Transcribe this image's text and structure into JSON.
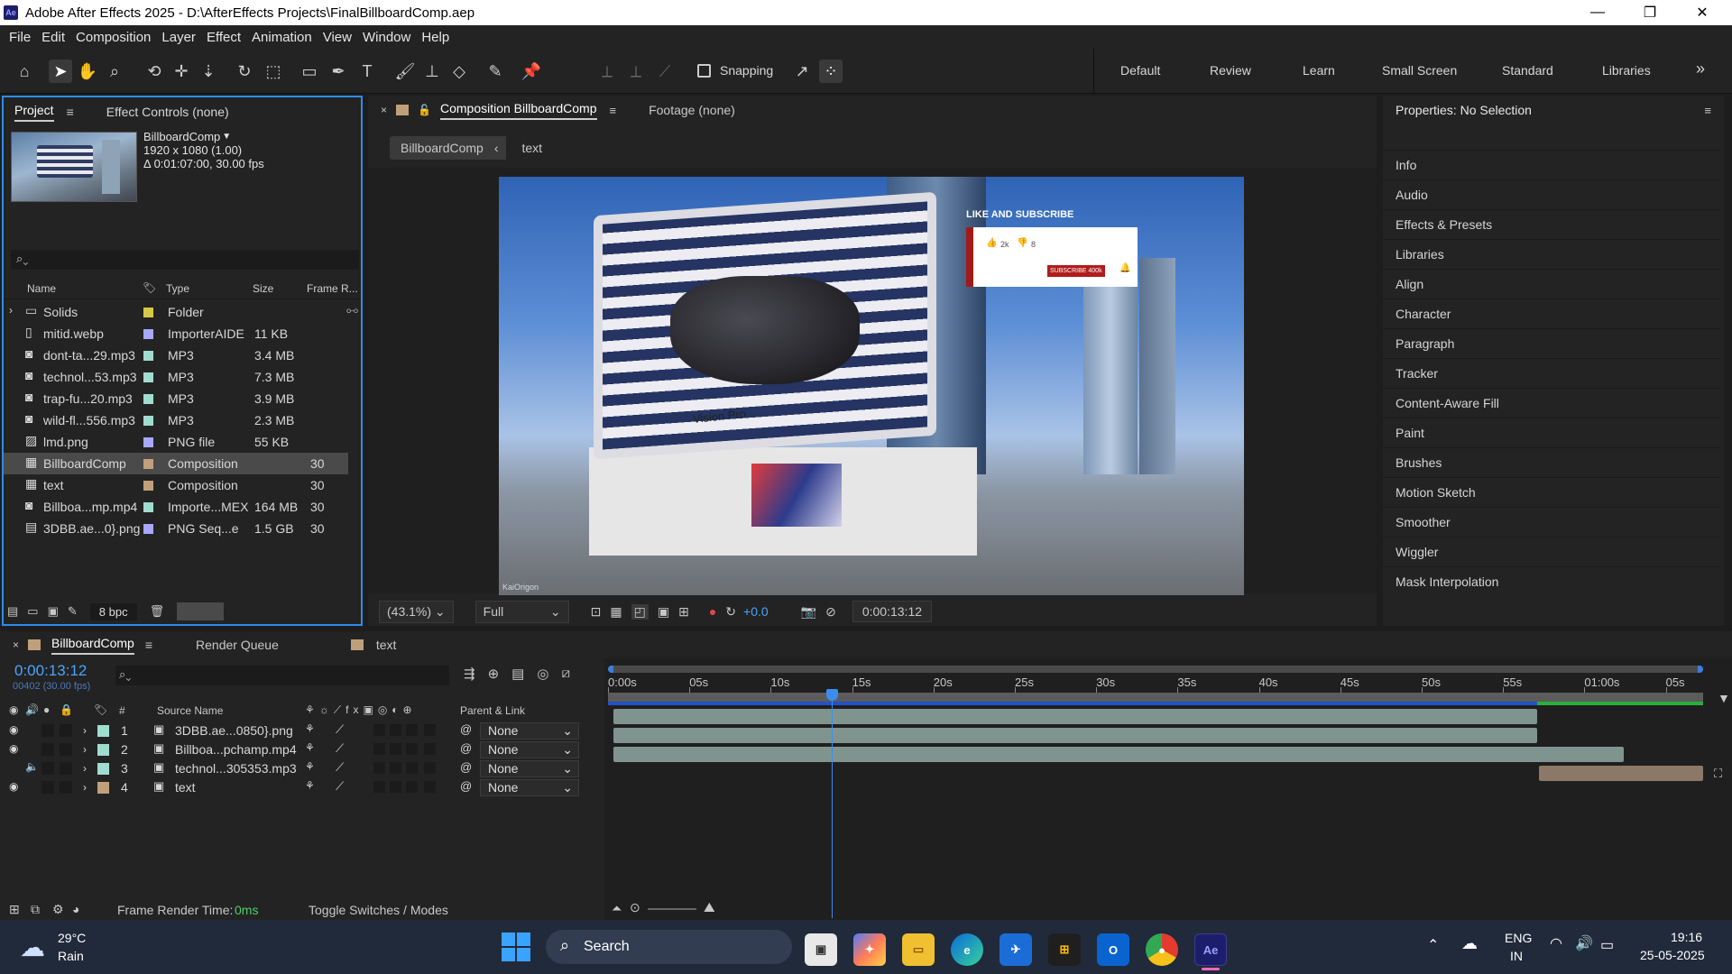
{
  "window": {
    "app_badge": "Ae",
    "title": "Adobe After Effects 2025 - D:\\AfterEffects Projects\\FinalBillboardComp.aep",
    "controls": [
      "—",
      "❐",
      "✕"
    ]
  },
  "menu": [
    "File",
    "Edit",
    "Composition",
    "Layer",
    "Effect",
    "Animation",
    "View",
    "Window",
    "Help"
  ],
  "toolbar": {
    "snapping_label": "Snapping",
    "workspaces": [
      "Default",
      "Review",
      "Learn",
      "Small Screen",
      "Standard",
      "Libraries"
    ],
    "more": "»"
  },
  "project": {
    "tabs": [
      "Project",
      "Effect Controls (none)"
    ],
    "selected_item": {
      "name": "BillboardComp",
      "dims": "1920 x 1080 (1.00)",
      "duration": "Δ 0:01:07:00, 30.00 fps"
    },
    "search_placeholder": "",
    "columns": [
      "Name",
      "Type",
      "Size",
      "Frame R..."
    ],
    "items": [
      {
        "name": "Solids",
        "type": "Folder",
        "size": "",
        "fps": "",
        "icon": "folder-icon",
        "label_color": "#d8c84a"
      },
      {
        "name": "mitid.webp",
        "type": "ImporterAIDE",
        "size": "11 KB",
        "fps": "",
        "icon": "file-icon",
        "label_color": "#a8a8ff"
      },
      {
        "name": "dont-ta...29.mp3",
        "type": "MP3",
        "size": "3.4 MB",
        "fps": "",
        "icon": "audio-file-icon",
        "label_color": "#a0dcd0"
      },
      {
        "name": "technol...53.mp3",
        "type": "MP3",
        "size": "7.3 MB",
        "fps": "",
        "icon": "audio-file-icon",
        "label_color": "#a0dcd0"
      },
      {
        "name": "trap-fu...20.mp3",
        "type": "MP3",
        "size": "3.9 MB",
        "fps": "",
        "icon": "audio-file-icon",
        "label_color": "#a0dcd0"
      },
      {
        "name": "wild-fl...556.mp3",
        "type": "MP3",
        "size": "2.3 MB",
        "fps": "",
        "icon": "audio-file-icon",
        "label_color": "#a0dcd0"
      },
      {
        "name": "lmd.png",
        "type": "PNG file",
        "size": "55 KB",
        "fps": "",
        "icon": "image-file-icon",
        "label_color": "#a8a8ff"
      },
      {
        "name": "BillboardComp",
        "type": "Composition",
        "size": "",
        "fps": "30",
        "icon": "composition-icon",
        "label_color": "#c0a07a",
        "selected": true
      },
      {
        "name": "text",
        "type": "Composition",
        "size": "",
        "fps": "30",
        "icon": "composition-icon",
        "label_color": "#c0a07a"
      },
      {
        "name": "Billboa...mp.mp4",
        "type": "Importe...MEX",
        "size": "164 MB",
        "fps": "30",
        "icon": "video-file-icon",
        "label_color": "#a0dcd0"
      },
      {
        "name": "3DBB.ae...0}.png",
        "type": "PNG Seq...e",
        "size": "1.5 GB",
        "fps": "30",
        "icon": "image-sequence-icon",
        "label_color": "#a8a8ff"
      }
    ],
    "bpc": "8 bpc"
  },
  "composition": {
    "tabs": [
      "Composition BillboardComp",
      "Footage (none)"
    ],
    "breadcrumb": [
      "BillboardComp",
      "text"
    ],
    "overlay": {
      "heading": "LIKE AND SUBSCRIBE",
      "likes": "2k",
      "dislikes": "8",
      "subscribe": "SUBSCRIBE 400k"
    },
    "sign_text": "Vision Pro",
    "watermark": "KaiOrigon",
    "zoom": "(43.1%)",
    "resolution": "Full",
    "exposure": "+0.0",
    "timecode": "0:00:13:12"
  },
  "properties": {
    "title": "Properties: No Selection",
    "items": [
      "Info",
      "Audio",
      "Effects & Presets",
      "Libraries",
      "Align",
      "Character",
      "Paragraph",
      "Tracker",
      "Content-Aware Fill",
      "Paint",
      "Brushes",
      "Motion Sketch",
      "Smoother",
      "Wiggler",
      "Mask Interpolation"
    ]
  },
  "timeline": {
    "tabs": [
      "BillboardComp",
      "Render Queue",
      "text"
    ],
    "timecode": "0:00:13:12",
    "frame_info": "00402 (30.00 fps)",
    "columns": {
      "num": "#",
      "source": "Source Name",
      "parent": "Parent & Link"
    },
    "ruler": [
      "0:00s",
      "05s",
      "10s",
      "15s",
      "20s",
      "25s",
      "30s",
      "35s",
      "40s",
      "45s",
      "50s",
      "55s",
      "01:00s",
      "05s"
    ],
    "layers": [
      {
        "num": "1",
        "name": "3DBB.ae...0850}.png",
        "parent": "None",
        "label_color": "#a0dcd0",
        "visible": true,
        "audio": false
      },
      {
        "num": "2",
        "name": "Billboa...pchamp.mp4",
        "parent": "None",
        "label_color": "#a0dcd0",
        "visible": true,
        "audio": false
      },
      {
        "num": "3",
        "name": "technol...305353.mp3",
        "parent": "None",
        "label_color": "#a0dcd0",
        "visible": false,
        "audio": true
      },
      {
        "num": "4",
        "name": "text",
        "parent": "None",
        "label_color": "#c0a07a",
        "visible": true,
        "audio": false
      }
    ],
    "footer": {
      "render_label": "Frame Render Time:",
      "render_value": "0ms",
      "toggle": "Toggle Switches / Modes"
    }
  },
  "taskbar": {
    "weather_temp": "29°C",
    "weather_desc": "Rain",
    "search_label": "Search",
    "lang_top": "ENG",
    "lang_bottom": "IN",
    "time": "19:16",
    "date": "25-05-2025"
  }
}
